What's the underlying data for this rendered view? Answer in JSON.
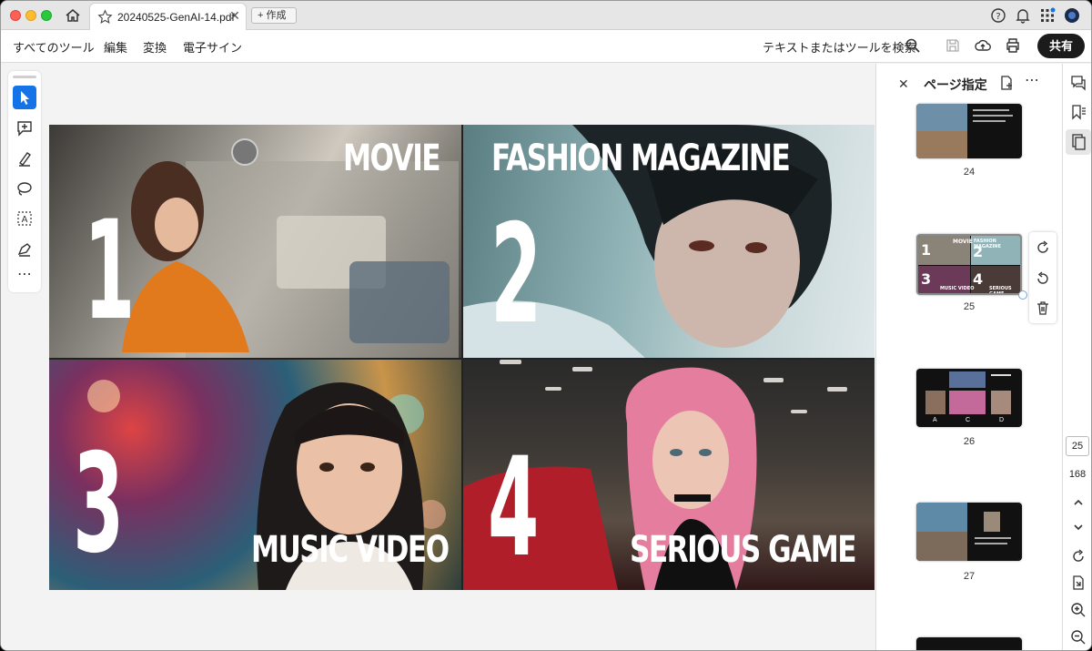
{
  "tabbar": {
    "tab_title": "20240525-GenAI-14.pdf",
    "new_tab_label": "+ 作成"
  },
  "menubar": {
    "items": [
      "すべてのツール",
      "編集",
      "変換",
      "電子サイン"
    ],
    "search_label": "テキストまたはツールを検索",
    "share_label": "共有"
  },
  "document": {
    "quadrants": [
      {
        "number": "1",
        "label": "MOVIE"
      },
      {
        "number": "2",
        "label": "FASHION MAGAZINE"
      },
      {
        "number": "3",
        "label": "MUSIC VIDEO"
      },
      {
        "number": "4",
        "label": "SERIOUS GAME"
      }
    ]
  },
  "pages_panel": {
    "title": "ページ指定",
    "thumbnails": [
      {
        "page": "24"
      },
      {
        "page": "25",
        "selected": true,
        "mini_labels": [
          "1",
          "MOVIE",
          "2",
          "FASHION MAGAZINE",
          "3",
          "MUSIC VIDEO",
          "4",
          "SERIOUS GAME"
        ]
      },
      {
        "page": "26",
        "mini_labels": [
          "A",
          "C",
          "D"
        ]
      },
      {
        "page": "27"
      }
    ]
  },
  "navigator": {
    "current_page": "25",
    "total_pages": "168"
  },
  "colors": {
    "accent": "#1473e6",
    "share_button": "#1b1b1b"
  }
}
